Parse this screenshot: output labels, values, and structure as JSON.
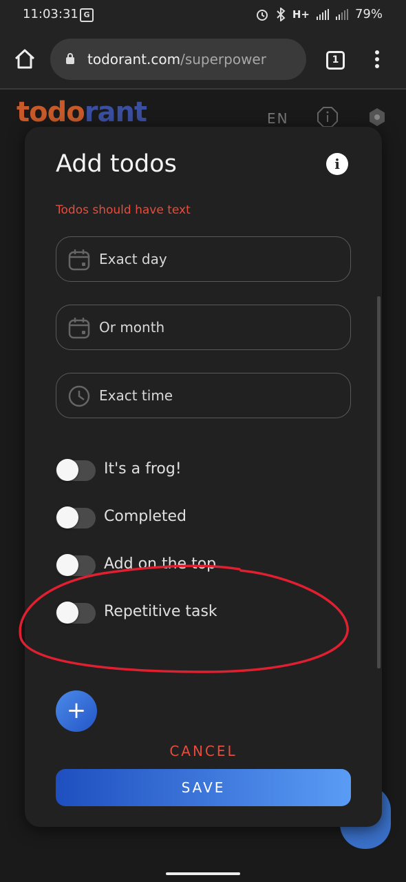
{
  "status_bar": {
    "time": "11:03:31",
    "network": "H+",
    "battery": "79%",
    "translate_badge": "G"
  },
  "browser": {
    "url_domain": "todorant.com",
    "url_path": "/superpower",
    "tab_count": "1"
  },
  "app": {
    "logo_part1": "todo",
    "logo_part2": "rant",
    "language": "EN",
    "colors": {
      "logo_orange": "#c85a2a",
      "logo_blue": "#3b4fa0"
    }
  },
  "dialog": {
    "title": "Add todos",
    "info_glyph": "i",
    "error": "Todos should have text",
    "fields": [
      {
        "label": "Exact day",
        "icon": "calendar-icon"
      },
      {
        "label": "Or month",
        "icon": "calendar-icon"
      },
      {
        "label": "Exact time",
        "icon": "clock-icon"
      }
    ],
    "toggles": [
      {
        "label": "It's a frog!",
        "checked": false
      },
      {
        "label": "Completed",
        "checked": false
      },
      {
        "label": "Add on the top",
        "checked": false
      },
      {
        "label": "Repetitive task",
        "checked": false
      }
    ],
    "add_glyph": "+",
    "cancel_label": "CANCEL",
    "save_label": "SAVE",
    "colors": {
      "error": "#e74c3c",
      "accent": "#2f6fe0",
      "annotation": "#e02030"
    }
  }
}
